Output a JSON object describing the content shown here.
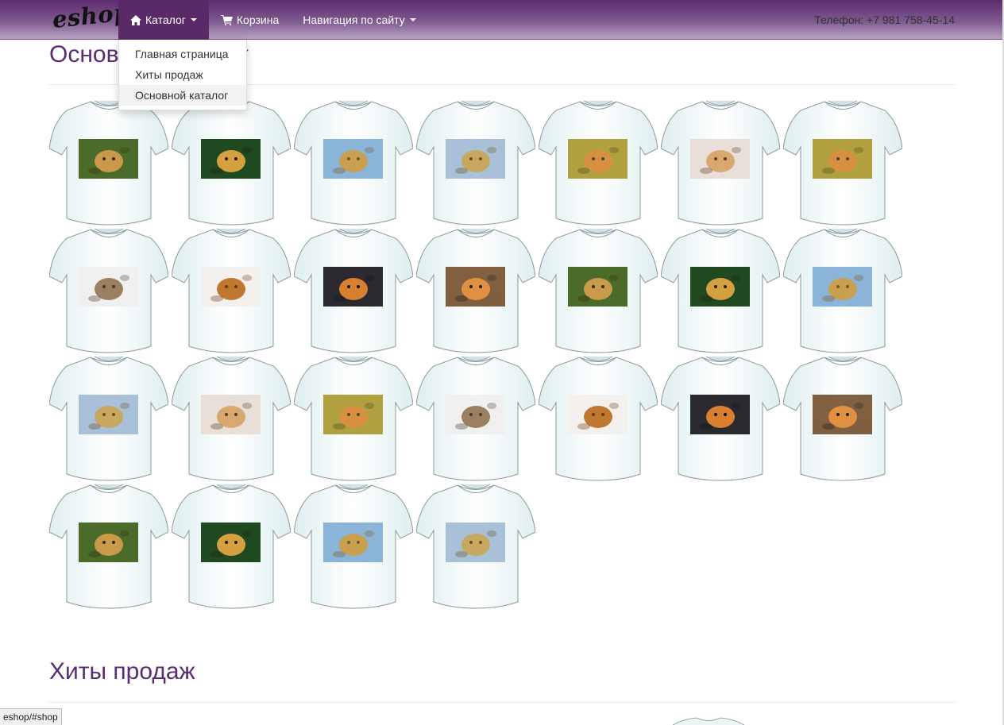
{
  "navbar": {
    "brand": "eshop",
    "items": [
      {
        "label": "Каталог",
        "icon": "home-icon",
        "dropdown": true,
        "active": true
      },
      {
        "label": "Корзина",
        "icon": "cart-icon",
        "dropdown": false,
        "active": false
      },
      {
        "label": "Навигация по сайту",
        "icon": "",
        "dropdown": true,
        "active": false
      }
    ],
    "phone": "Телефон: +7 981 758-45-14"
  },
  "dropdown": {
    "items": [
      "Главная страница",
      "Хиты продаж",
      "Основной каталог"
    ],
    "hovered_index": 2
  },
  "sections": {
    "main_catalog": {
      "title": "Основной каталог"
    },
    "bestsellers": {
      "title": "Хиты продаж"
    }
  },
  "catalog_items": [
    "leopard",
    "jaguar",
    "lion",
    "giraffe",
    "owl",
    "kitten",
    "owl",
    "tabby-cat",
    "puppy",
    "tiger-water",
    "tiger-lying",
    "leopard",
    "jaguar",
    "lion",
    "giraffe",
    "kitten",
    "owl",
    "tabby-cat",
    "puppy",
    "tiger-water",
    "tiger-lying",
    "leopard",
    "jaguar",
    "lion",
    "giraffe"
  ],
  "status_bar": "eshop/#shop",
  "colors": {
    "brand_purple": "#5a2d70",
    "nav_active": "#5a2968"
  }
}
